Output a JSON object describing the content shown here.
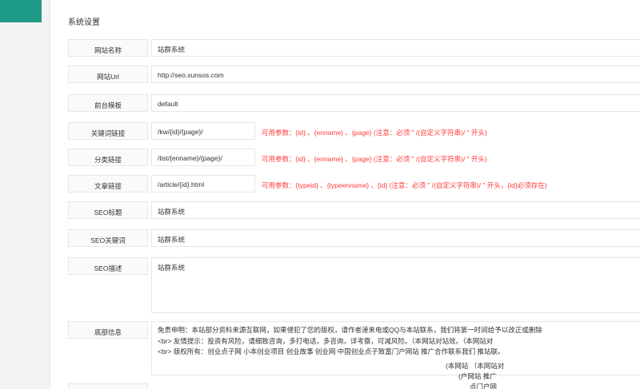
{
  "page": {
    "title": "系统设置"
  },
  "rows": {
    "site_name": {
      "label": "网站名称",
      "value": "站群系统"
    },
    "site_url": {
      "label": "网站Url",
      "value": "http://seo.xunsos.com"
    },
    "template": {
      "label": "前台模板",
      "value": "default"
    },
    "keyword_link": {
      "label": "关键词链接",
      "value": "/kw/{id}/{page}/",
      "hint": "可用参数：{id} 、{enname} 、{page} (注意：必须 \" /(自定义字符串)/ \" 开头)"
    },
    "category_link": {
      "label": "分类链接",
      "value": "/list/{enname}/{page}/",
      "hint": "可用参数：{id} 、{enname} 、{page} (注意：必须 \" /(自定义字符串)/ \" 开头)"
    },
    "article_link": {
      "label": "文章链接",
      "value": "/article/{id}.html",
      "hint": "可用参数：{typeid} 、{typeenname} 、{id} (注意：必须 \" /(自定义字符串)/ \" 开头，{id}必须存在)"
    },
    "seo_title": {
      "label": "SEO标题",
      "value": "站群系统"
    },
    "seo_keywords": {
      "label": "SEO关键词",
      "value": "站群系统"
    },
    "seo_description": {
      "label": "SEO描述",
      "value": "站群系统"
    },
    "footer": {
      "label": "底部信息",
      "lines": [
        "免责申明：本站部分资料来源互联网，如果侵犯了您的版权，请作者速来电或QQ与本站联系，我们将第一时间给予以改正或删除",
        "<br> 友情提示：投资有风险，请细致咨询，多打电话，多咨询，详考察，可减风险。（本网站对站效。（本网站对",
        "<br> 版权所有：创业点子网 小本创业项目 创业故事 创业网 中国创业点子致富门户网站 推广合作联系我们 推站联。",
        "(本网站 （本网站对",
        "(户网站 推广",
        "点门户网"
      ]
    }
  }
}
